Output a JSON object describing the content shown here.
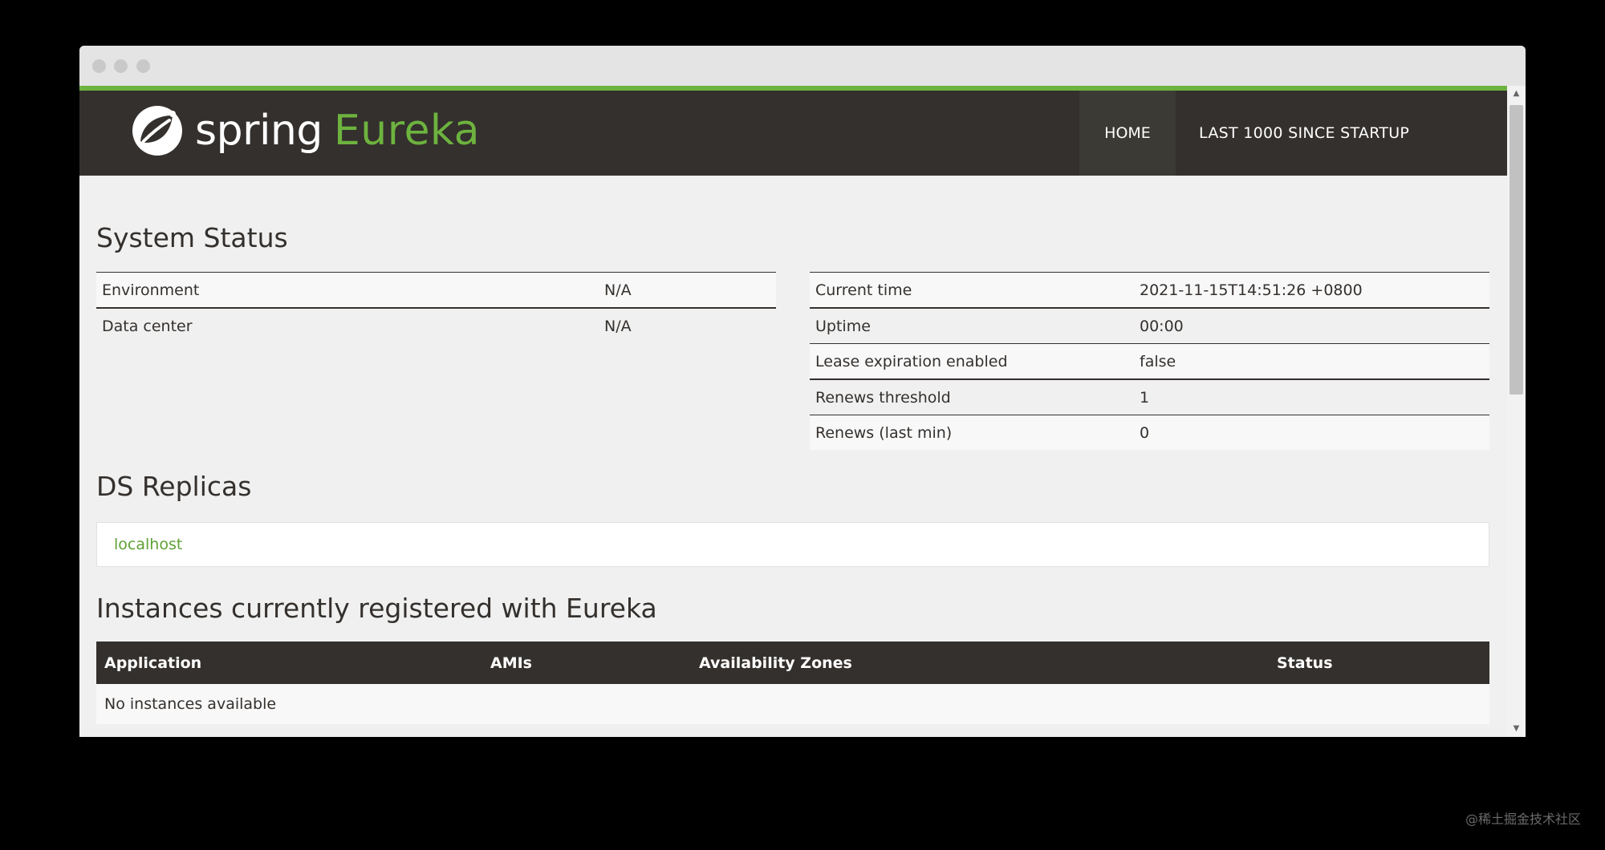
{
  "brand": {
    "spring": "spring",
    "eureka": "Eureka",
    "color_green": "#6db33f",
    "color_dark": "#34302d"
  },
  "nav": {
    "home": "HOME",
    "last1000": "LAST 1000 SINCE STARTUP"
  },
  "system_status": {
    "title": "System Status",
    "left": [
      {
        "key": "Environment",
        "value": "N/A"
      },
      {
        "key": "Data center",
        "value": "N/A"
      }
    ],
    "right": [
      {
        "key": "Current time",
        "value": "2021-11-15T14:51:26 +0800"
      },
      {
        "key": "Uptime",
        "value": "00:00"
      },
      {
        "key": "Lease expiration enabled",
        "value": "false"
      },
      {
        "key": "Renews threshold",
        "value": "1"
      },
      {
        "key": "Renews (last min)",
        "value": "0"
      }
    ]
  },
  "replicas": {
    "title": "DS Replicas",
    "items": [
      "localhost"
    ]
  },
  "instances": {
    "title": "Instances currently registered with Eureka",
    "columns": [
      "Application",
      "AMIs",
      "Availability Zones",
      "Status"
    ],
    "empty_message": "No instances available"
  },
  "watermark": "@稀土掘金技术社区"
}
